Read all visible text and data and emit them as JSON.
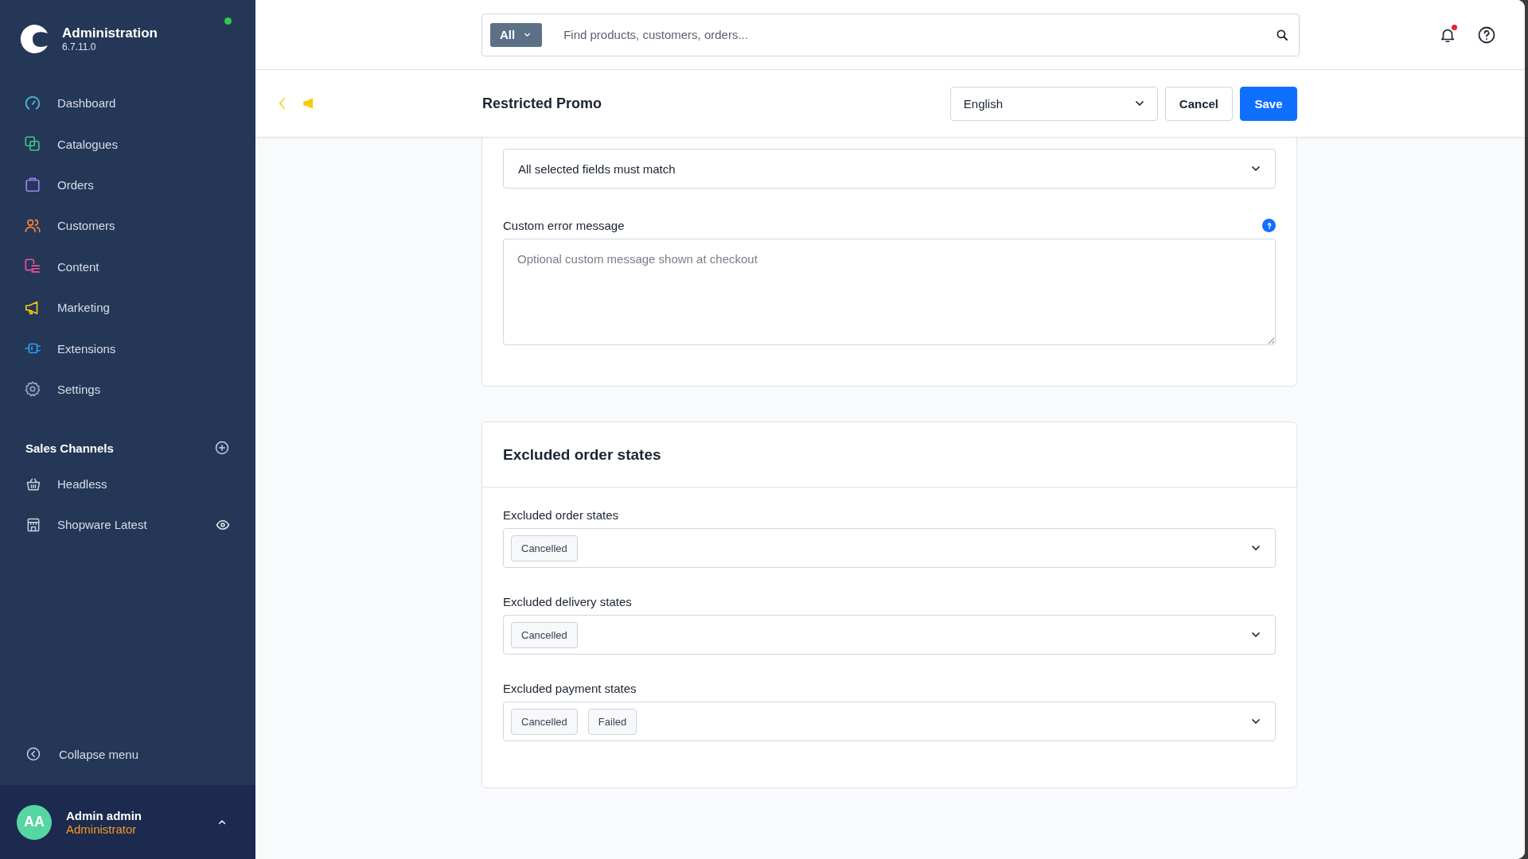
{
  "app": {
    "title": "Administration",
    "version": "6.7.11.0",
    "online": true
  },
  "nav": [
    {
      "label": "Dashboard",
      "kind": "dashboard"
    },
    {
      "label": "Catalogues",
      "kind": "catalogues"
    },
    {
      "label": "Orders",
      "kind": "orders"
    },
    {
      "label": "Customers",
      "kind": "customers"
    },
    {
      "label": "Content",
      "kind": "content"
    },
    {
      "label": "Marketing",
      "kind": "marketing"
    },
    {
      "label": "Extensions",
      "kind": "extensions"
    },
    {
      "label": "Settings",
      "kind": "settings"
    }
  ],
  "sales_channels": {
    "title": "Sales Channels",
    "items": [
      {
        "label": "Headless",
        "kind": "basket",
        "preview": false
      },
      {
        "label": "Shopware Latest",
        "kind": "store",
        "preview": true
      }
    ]
  },
  "collapse_label": "Collapse menu",
  "user": {
    "initials": "AA",
    "name": "Admin admin",
    "role": "Administrator"
  },
  "search": {
    "scope": "All",
    "placeholder": "Find products, customers, orders..."
  },
  "notifications": {
    "unread": true
  },
  "page": {
    "title": "Restricted Promo",
    "language": "English",
    "buttons": [
      {
        "label": "Cancel",
        "kind": "secondary"
      },
      {
        "label": "Save",
        "kind": "primary"
      }
    ]
  },
  "cards": [
    {
      "fields": [
        {
          "kind": "select",
          "value": "All selected fields must match"
        },
        {
          "kind": "textarea",
          "label": "Custom error message",
          "placeholder": "Optional custom message shown at checkout",
          "help": true
        }
      ]
    },
    {
      "title": "Excluded order states",
      "fields": [
        {
          "kind": "multiselect",
          "label": "Excluded order states",
          "tags": [
            "Cancelled"
          ]
        },
        {
          "kind": "multiselect",
          "label": "Excluded delivery states",
          "tags": [
            "Cancelled"
          ]
        },
        {
          "kind": "multiselect",
          "label": "Excluded payment states",
          "tags": [
            "Cancelled",
            "Failed"
          ]
        }
      ]
    }
  ]
}
